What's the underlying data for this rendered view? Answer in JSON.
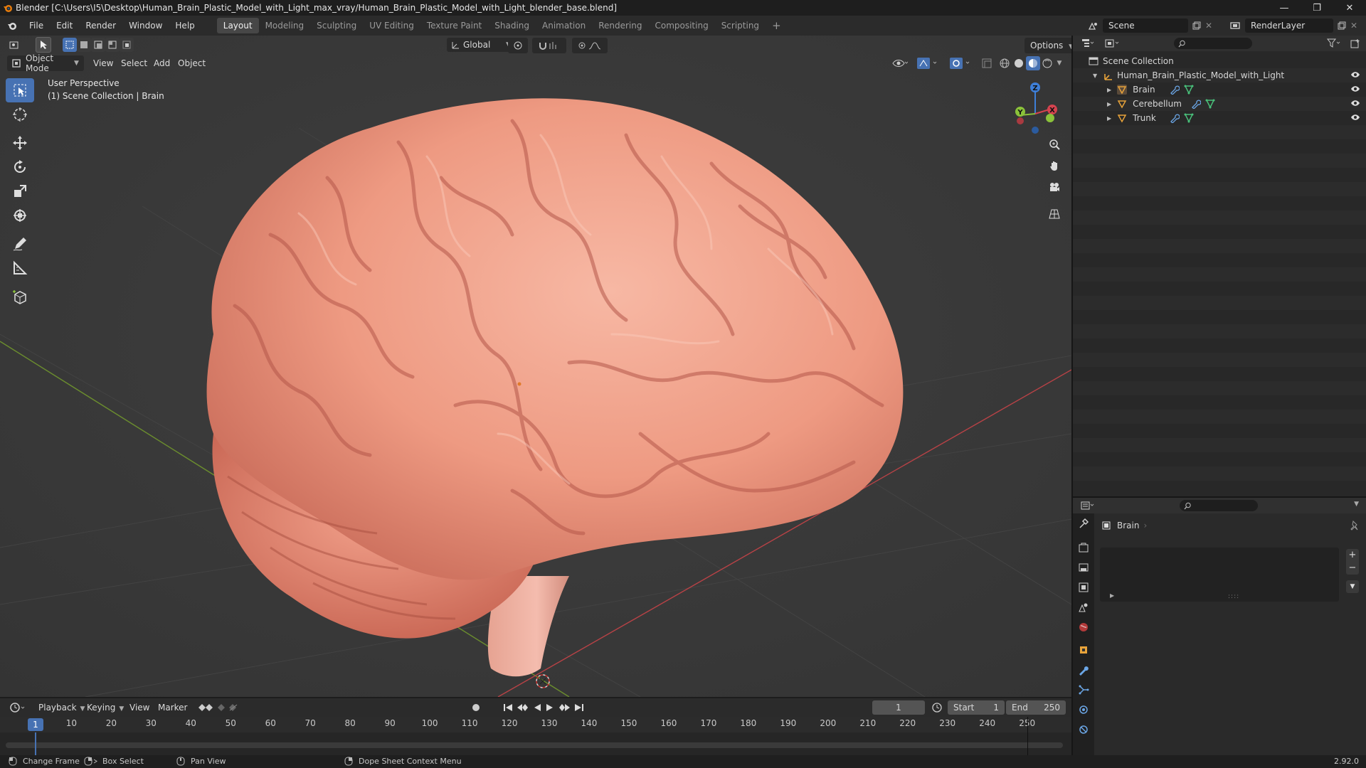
{
  "window": {
    "title": "Blender [C:\\Users\\I5\\Desktop\\Human_Brain_Plastic_Model_with_Light_max_vray/Human_Brain_Plastic_Model_with_Light_blender_base.blend]",
    "buttons": [
      "minimize",
      "maximize",
      "close"
    ]
  },
  "menubar": {
    "menus": [
      "File",
      "Edit",
      "Render",
      "Window",
      "Help"
    ],
    "workspaces": [
      "Layout",
      "Modeling",
      "Sculpting",
      "UV Editing",
      "Texture Paint",
      "Shading",
      "Animation",
      "Rendering",
      "Compositing",
      "Scripting"
    ],
    "active_workspace": "Layout",
    "scene": "Scene",
    "view_layer": "RenderLayer"
  },
  "viewport": {
    "mode": "Object Mode",
    "menus": [
      "View",
      "Select",
      "Add",
      "Object"
    ],
    "transform_orientation": "Global",
    "options_label": "Options",
    "overlay_line1": "User Perspective",
    "overlay_line2": "(1) Scene Collection | Brain",
    "gizmo_axes": [
      "Z",
      "Y",
      "X"
    ],
    "colors": {
      "background": "#393939",
      "active_tool": "#4772b3",
      "x_axis": "#d5434f",
      "y_axis": "#8bc23a",
      "z_axis": "#3e7fd8",
      "brain": "#f0a088"
    }
  },
  "tools": [
    "cursor-select",
    "3d-cursor",
    "move",
    "rotate",
    "scale",
    "transform",
    "annotate",
    "measure",
    "add-cube"
  ],
  "outliner": {
    "root": "Scene Collection",
    "collection": "Human_Brain_Plastic_Model_with_Light",
    "objects": [
      "Brain",
      "Cerebellum",
      "Trunk"
    ]
  },
  "properties": {
    "object_name": "Brain",
    "tabs": [
      "tool",
      "render",
      "output",
      "view-layer",
      "scene",
      "world",
      "object",
      "modifiers",
      "particles",
      "physics",
      "constraints"
    ]
  },
  "timeline": {
    "menus": [
      "Playback",
      "Keying",
      "View",
      "Marker"
    ],
    "current_frame": "1",
    "start_label": "Start",
    "start": "1",
    "end_label": "End",
    "end": "250",
    "ticks": [
      "10",
      "20",
      "30",
      "40",
      "50",
      "60",
      "70",
      "80",
      "90",
      "100",
      "110",
      "120",
      "130",
      "140",
      "150",
      "160",
      "170",
      "180",
      "190",
      "200",
      "210",
      "220",
      "230",
      "240",
      "250"
    ],
    "playhead": "1"
  },
  "statusbar": {
    "items": [
      "Change Frame",
      "Box Select",
      "Pan View",
      "Dope Sheet Context Menu"
    ],
    "version": "2.92.0"
  }
}
